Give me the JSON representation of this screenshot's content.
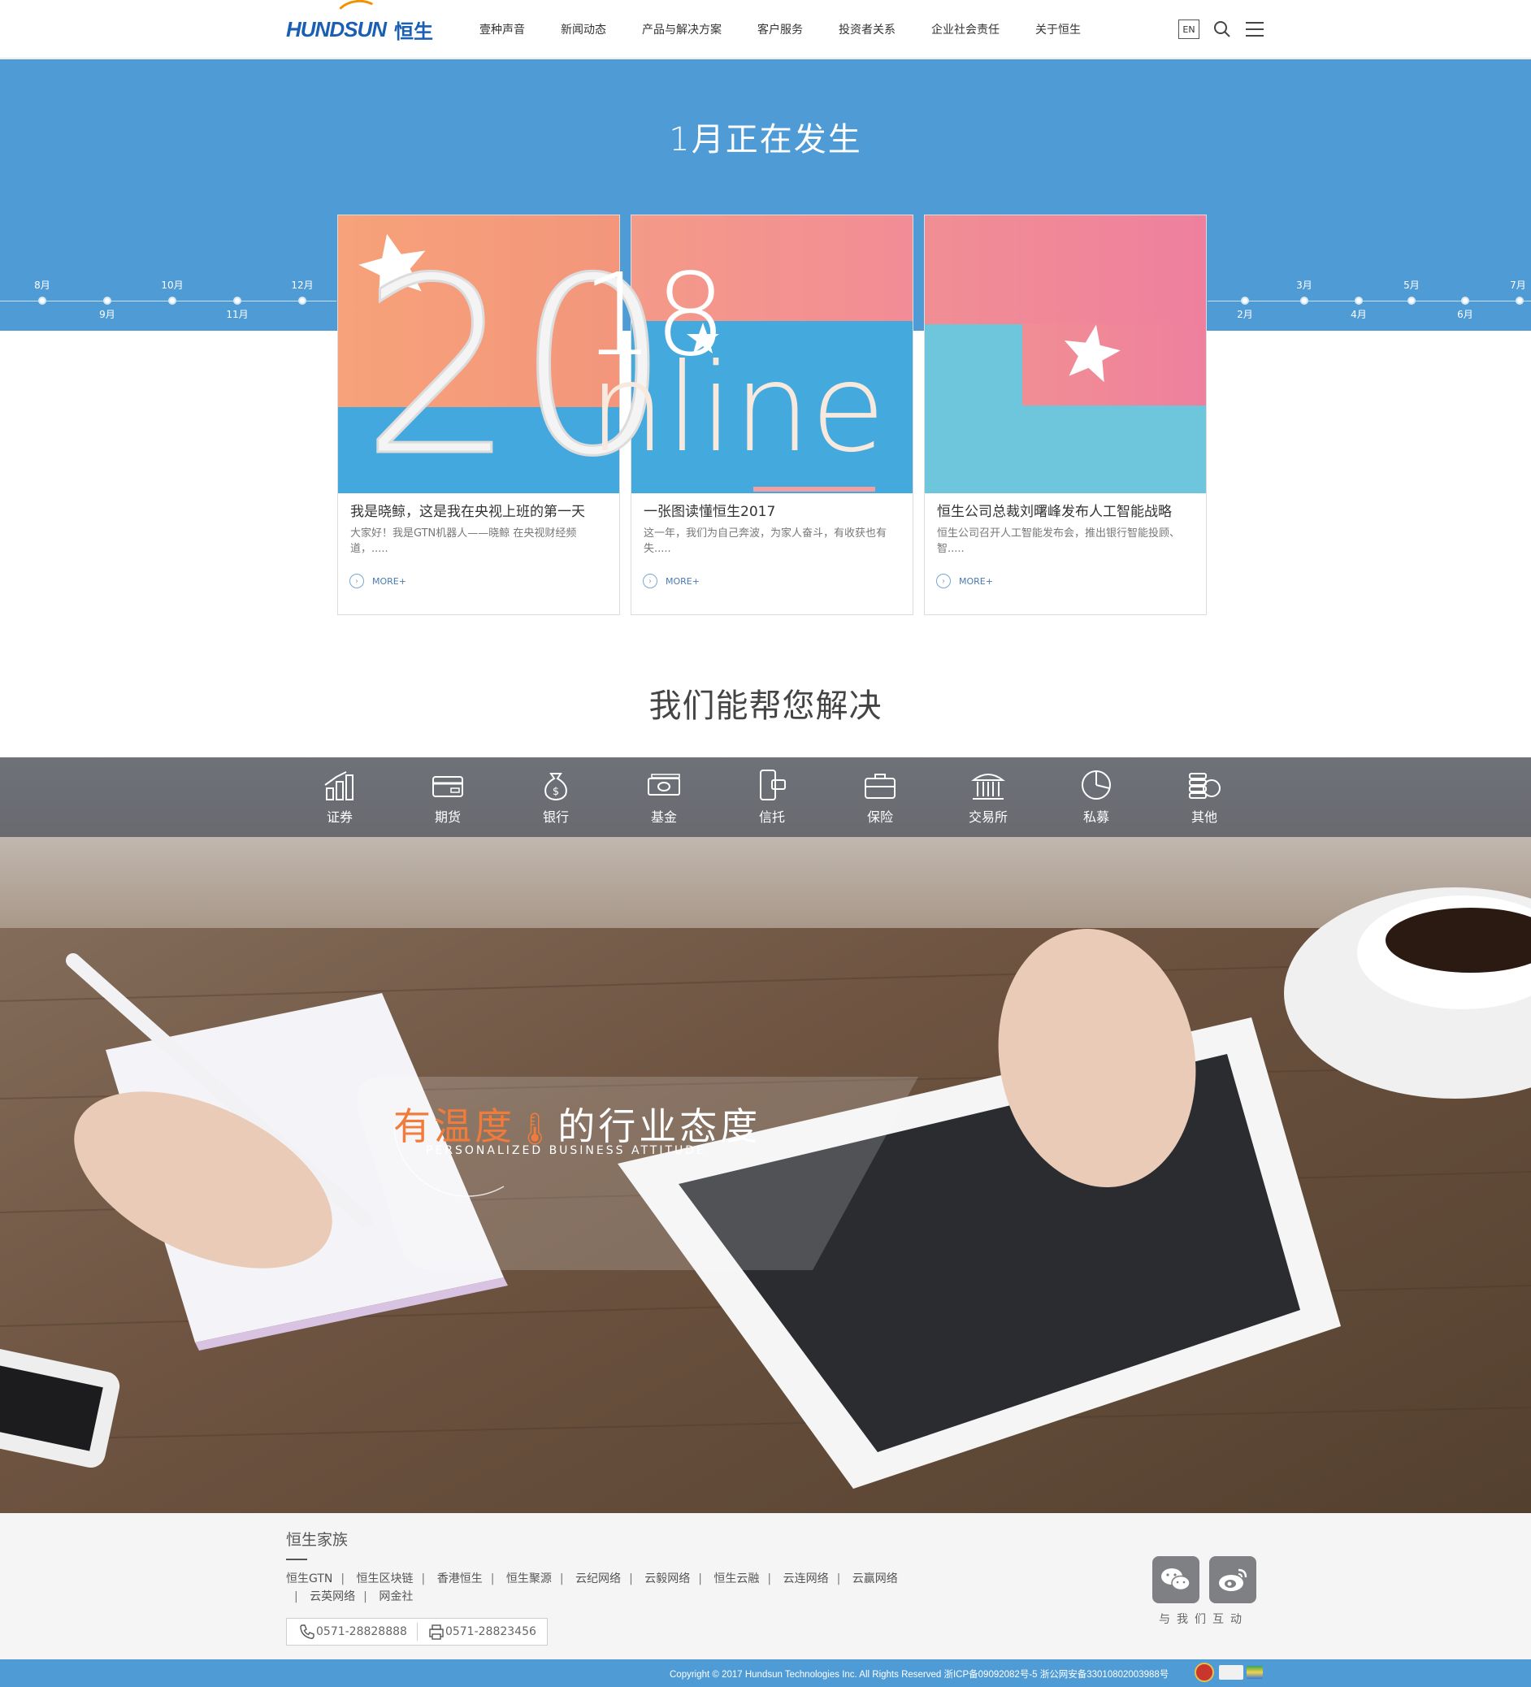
{
  "header": {
    "logo_text": "HUNDSUN",
    "logo_cn": "恒生",
    "nav": [
      "壹种声音",
      "新闻动态",
      "产品与解决方案",
      "客户服务",
      "投资者关系",
      "企业社会责任",
      "关于恒生"
    ],
    "lang_label": "EN",
    "icons": [
      "search-icon",
      "menu-icon"
    ]
  },
  "hero": {
    "title": "1月正在发生",
    "timeline_left": [
      "8月",
      "9月",
      "10月",
      "11月",
      "12月"
    ],
    "timeline_right": [
      "2月",
      "3月",
      "4月",
      "5月",
      "6月",
      "7月"
    ]
  },
  "banner_text": {
    "year_a": "20",
    "year_b": "18",
    "word_o": "0",
    "word_rest": "nline"
  },
  "cards": [
    {
      "title": "我是晓鲸，这是我在央视上班的第一天",
      "desc": "大家好！我是GTN机器人——晓鲸 在央视财经频道，.....",
      "more": "MORE+"
    },
    {
      "title": "一张图读懂恒生2017",
      "desc": "这一年，我们为自己奔波，为家人奋斗，有收获也有失.....",
      "more": "MORE+"
    },
    {
      "title": "恒生公司总裁刘曙峰发布人工智能战略",
      "desc": "恒生公司召开人工智能发布会，推出银行智能投顾、智.....",
      "more": "MORE+"
    }
  ],
  "solutions": {
    "title": "我们能帮您解决",
    "categories": [
      {
        "label": "证券",
        "icon": "bar-chart-icon"
      },
      {
        "label": "期货",
        "icon": "card-icon"
      },
      {
        "label": "银行",
        "icon": "money-bag-icon"
      },
      {
        "label": "基金",
        "icon": "banknote-icon"
      },
      {
        "label": "信托",
        "icon": "phone-card-icon"
      },
      {
        "label": "保险",
        "icon": "briefcase-icon"
      },
      {
        "label": "交易所",
        "icon": "building-icon"
      },
      {
        "label": "私募",
        "icon": "pie-chart-icon"
      },
      {
        "label": "其他",
        "icon": "coins-icon"
      }
    ],
    "slogan_highlight": "有温度",
    "slogan_rest": "的行业态度",
    "slogan_sub": "PERSONALIZED BUSINESS ATTITUDE"
  },
  "footer": {
    "family_title": "恒生家族",
    "links": [
      "恒生GTN",
      "恒生区块链",
      "香港恒生",
      "恒生聚源",
      "云纪网络",
      "云毅网络",
      "恒生云融",
      "云连网络",
      "云赢网络",
      "云英网络",
      "网金社"
    ],
    "phone": "0571-28828888",
    "fax": "0571-28823456",
    "social_label": "与我们互动",
    "copyright": "Copyright © 2017 Hundsun Technologies Inc. All Rights Reserved 浙ICP备09092082号-5 浙公网安备33010802003988号"
  },
  "colors": {
    "brand_blue": "#4e9bd6",
    "logo_blue": "#1a5fb4",
    "accent_orange": "#f29100",
    "slogan_orange": "#f07b3a"
  }
}
